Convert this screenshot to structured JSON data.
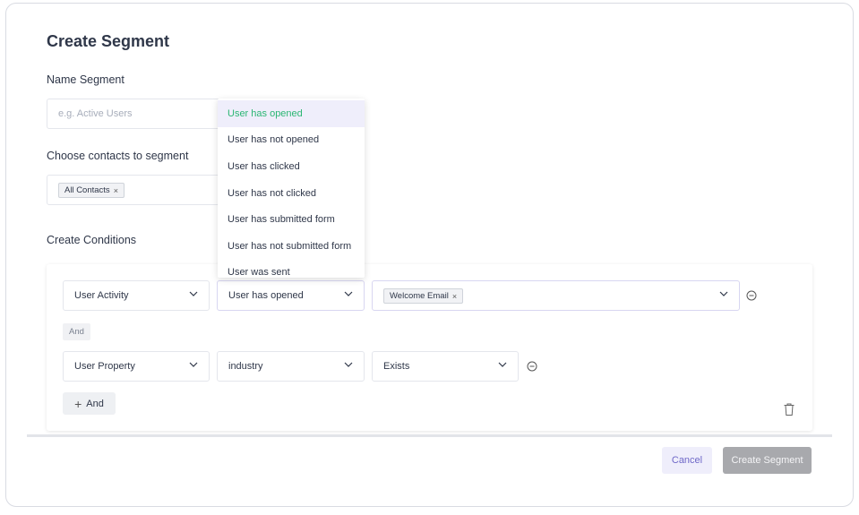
{
  "modal": {
    "title": "Create Segment",
    "name_label": "Name Segment",
    "name_placeholder": "e.g. Active Users",
    "contacts_label": "Choose contacts to segment",
    "contacts_tag": "All Contacts",
    "conditions_label": "Create Conditions"
  },
  "conditions": {
    "row1": {
      "field": "User Activity",
      "operator": "User has opened",
      "value_tag": "Welcome Email"
    },
    "and_badge": "And",
    "row2": {
      "field": "User Property",
      "operator": "industry",
      "value": "Exists"
    },
    "add_and_label": "And"
  },
  "dropdown": {
    "items": [
      "User has opened",
      "User has not opened",
      "User has clicked",
      "User has not clicked",
      "User has submitted form",
      "User has not submitted form",
      "User was sent"
    ],
    "selected_index": 0
  },
  "footer": {
    "cancel_label": "Cancel",
    "create_label": "Create Segment"
  },
  "icons": {
    "tag_remove": "close-icon",
    "select_caret": "chevron-down-icon",
    "remove_condition": "minus-circle-icon",
    "delete_group": "trash-icon",
    "add": "plus-icon"
  },
  "colors": {
    "accent": "#6f68c8",
    "selected_item_text": "#2bb673",
    "selected_item_bg": "#efeefb",
    "disabled_button": "#a8a9ad"
  }
}
